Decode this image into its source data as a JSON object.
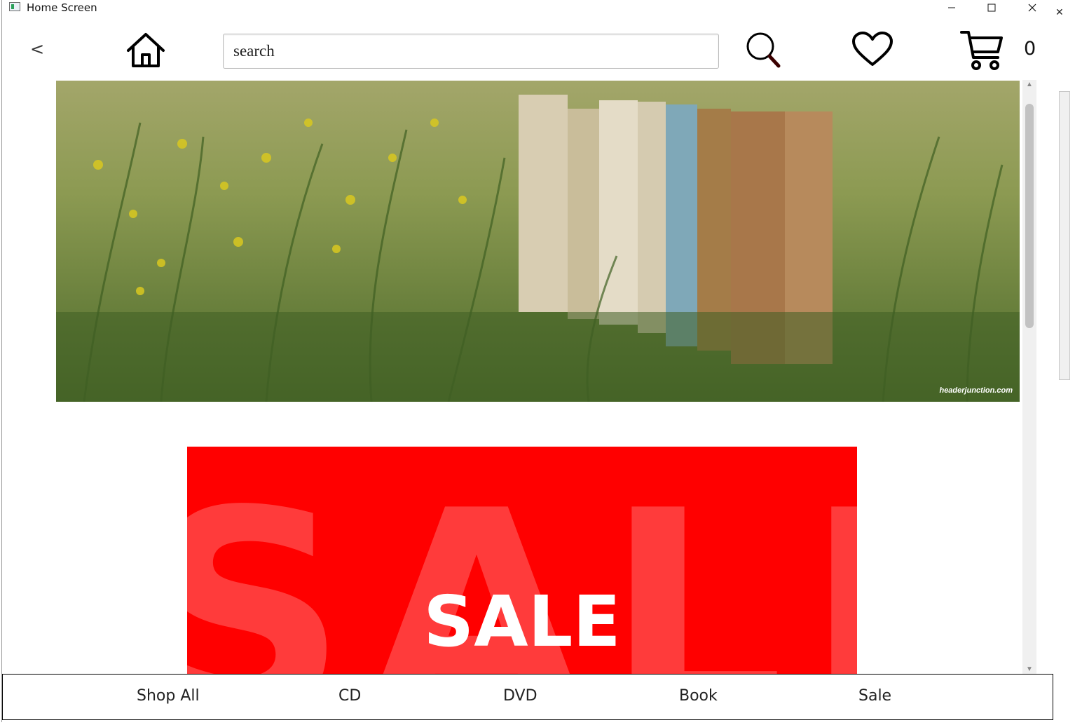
{
  "window": {
    "title": "Home Screen",
    "minimize_icon": "minimize-icon",
    "maximize_icon": "maximize-icon",
    "close_icon": "close-icon"
  },
  "toolbar": {
    "back_label": "<",
    "home_icon": "home-icon",
    "search": {
      "value": "search",
      "placeholder": "search"
    },
    "search_icon": "magnifier-icon",
    "favorites_icon": "heart-icon",
    "cart_icon": "cart-icon",
    "cart_count": "0"
  },
  "banner": {
    "image": "books-in-grass-photo",
    "watermark": "headerjunction.com"
  },
  "sale_banner": {
    "background_letters": "SALE",
    "text": "SALE",
    "background_color": "#ff0000"
  },
  "bottom_nav": {
    "items": [
      {
        "label": "Shop All"
      },
      {
        "label": "CD"
      },
      {
        "label": "DVD"
      },
      {
        "label": "Book"
      },
      {
        "label": "Sale"
      }
    ]
  }
}
